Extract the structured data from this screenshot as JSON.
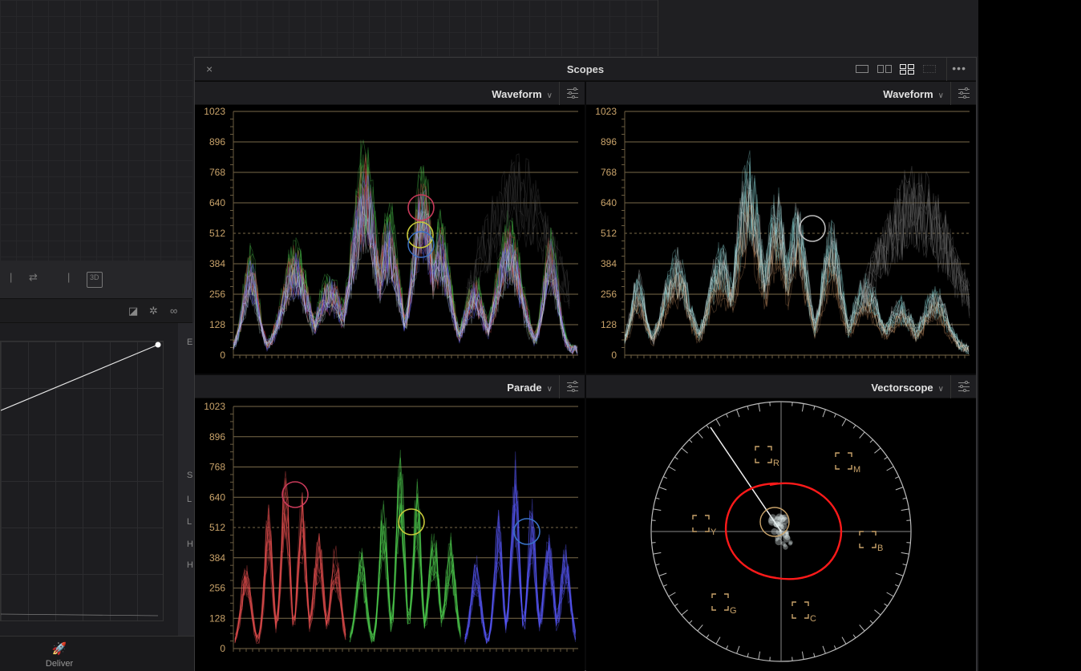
{
  "app": {
    "deliver_label": "Deliver",
    "badge_3d": "3D",
    "side_letters": [
      "E",
      "S",
      "L",
      "L",
      "H",
      "H"
    ]
  },
  "scopes": {
    "title": "Scopes",
    "close_label": "×",
    "more_label": "•••",
    "layouts": [
      "single",
      "dual",
      "quad",
      "grid"
    ],
    "active_layout": "quad",
    "panels": [
      {
        "name": "waveform-left",
        "label": "Waveform"
      },
      {
        "name": "waveform-right",
        "label": "Waveform"
      },
      {
        "name": "parade",
        "label": "Parade"
      },
      {
        "name": "vectorscope",
        "label": "Vectorscope"
      }
    ],
    "scale_ticks": [
      "1023",
      "896",
      "768",
      "640",
      "512",
      "384",
      "256",
      "128",
      "0"
    ],
    "vectorscope_targets": [
      "R",
      "M",
      "Y",
      "B",
      "G",
      "C"
    ],
    "colors": {
      "tick": "#c9a36a",
      "red": "#e85050",
      "green": "#4fd14f",
      "blue": "#5a5aff",
      "annotation": "#ff1a1a"
    }
  }
}
